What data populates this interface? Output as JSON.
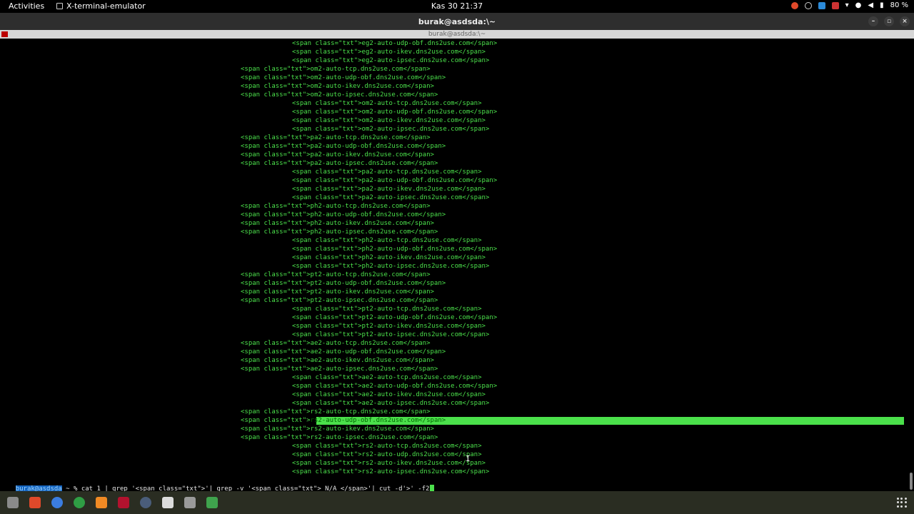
{
  "topbar": {
    "activities": "Activities",
    "app_name": "X-terminal-emulator",
    "clock": "Kas 30  21:37",
    "battery": "80 %",
    "tray_icons": [
      "brave-tray-icon",
      "settings-tray-icon",
      "app-tray-icon",
      "shield-tray-icon",
      "wifi-icon",
      "microphone-icon",
      "volume-icon",
      "battery-icon"
    ]
  },
  "window": {
    "title": "burak@asdsda:\\~",
    "tab_title": "burak@asdsda:\\~",
    "minimize": "–",
    "maximize": "▫",
    "close": "×"
  },
  "terminal": {
    "lines": [
      {
        "indent": 2,
        "text": "<span class=\"txt\">eg2-auto-udp-obf.dns2use.com</span>"
      },
      {
        "indent": 2,
        "text": "<span class=\"txt\">eg2-auto-ikev.dns2use.com</span>"
      },
      {
        "indent": 2,
        "text": "<span class=\"txt\">eg2-auto-ipsec.dns2use.com</span>"
      },
      {
        "indent": 1,
        "text": "<span class=\"txt\">om2-auto-tcp.dns2use.com</span>"
      },
      {
        "indent": 1,
        "text": "<span class=\"txt\">om2-auto-udp-obf.dns2use.com</span>"
      },
      {
        "indent": 1,
        "text": "<span class=\"txt\">om2-auto-ikev.dns2use.com</span>"
      },
      {
        "indent": 1,
        "text": "<span class=\"txt\">om2-auto-ipsec.dns2use.com</span>"
      },
      {
        "indent": 2,
        "text": "<span class=\"txt\">om2-auto-tcp.dns2use.com</span>"
      },
      {
        "indent": 2,
        "text": "<span class=\"txt\">om2-auto-udp-obf.dns2use.com</span>"
      },
      {
        "indent": 2,
        "text": "<span class=\"txt\">om2-auto-ikev.dns2use.com</span>"
      },
      {
        "indent": 2,
        "text": "<span class=\"txt\">om2-auto-ipsec.dns2use.com</span>"
      },
      {
        "indent": 1,
        "text": "<span class=\"txt\">pa2-auto-tcp.dns2use.com</span>"
      },
      {
        "indent": 1,
        "text": "<span class=\"txt\">pa2-auto-udp-obf.dns2use.com</span>"
      },
      {
        "indent": 1,
        "text": "<span class=\"txt\">pa2-auto-ikev.dns2use.com</span>"
      },
      {
        "indent": 1,
        "text": "<span class=\"txt\">pa2-auto-ipsec.dns2use.com</span>"
      },
      {
        "indent": 2,
        "text": "<span class=\"txt\">pa2-auto-tcp.dns2use.com</span>"
      },
      {
        "indent": 2,
        "text": "<span class=\"txt\">pa2-auto-udp-obf.dns2use.com</span>"
      },
      {
        "indent": 2,
        "text": "<span class=\"txt\">pa2-auto-ikev.dns2use.com</span>"
      },
      {
        "indent": 2,
        "text": "<span class=\"txt\">pa2-auto-ipsec.dns2use.com</span>"
      },
      {
        "indent": 1,
        "text": "<span class=\"txt\">ph2-auto-tcp.dns2use.com</span>"
      },
      {
        "indent": 1,
        "text": "<span class=\"txt\">ph2-auto-udp-obf.dns2use.com</span>"
      },
      {
        "indent": 1,
        "text": "<span class=\"txt\">ph2-auto-ikev.dns2use.com</span>"
      },
      {
        "indent": 1,
        "text": "<span class=\"txt\">ph2-auto-ipsec.dns2use.com</span>"
      },
      {
        "indent": 2,
        "text": "<span class=\"txt\">ph2-auto-tcp.dns2use.com</span>"
      },
      {
        "indent": 2,
        "text": "<span class=\"txt\">ph2-auto-udp-obf.dns2use.com</span>"
      },
      {
        "indent": 2,
        "text": "<span class=\"txt\">ph2-auto-ikev.dns2use.com</span>"
      },
      {
        "indent": 2,
        "text": "<span class=\"txt\">ph2-auto-ipsec.dns2use.com</span>"
      },
      {
        "indent": 1,
        "text": "<span class=\"txt\">pt2-auto-tcp.dns2use.com</span>"
      },
      {
        "indent": 1,
        "text": "<span class=\"txt\">pt2-auto-udp-obf.dns2use.com</span>"
      },
      {
        "indent": 1,
        "text": "<span class=\"txt\">pt2-auto-ikev.dns2use.com</span>"
      },
      {
        "indent": 1,
        "text": "<span class=\"txt\">pt2-auto-ipsec.dns2use.com</span>"
      },
      {
        "indent": 2,
        "text": "<span class=\"txt\">pt2-auto-tcp.dns2use.com</span>"
      },
      {
        "indent": 2,
        "text": "<span class=\"txt\">pt2-auto-udp-obf.dns2use.com</span>"
      },
      {
        "indent": 2,
        "text": "<span class=\"txt\">pt2-auto-ikev.dns2use.com</span>"
      },
      {
        "indent": 2,
        "text": "<span class=\"txt\">pt2-auto-ipsec.dns2use.com</span>"
      },
      {
        "indent": 1,
        "text": "<span class=\"txt\">ae2-auto-tcp.dns2use.com</span>"
      },
      {
        "indent": 1,
        "text": "<span class=\"txt\">ae2-auto-udp-obf.dns2use.com</span>"
      },
      {
        "indent": 1,
        "text": "<span class=\"txt\">ae2-auto-ikev.dns2use.com</span>"
      },
      {
        "indent": 1,
        "text": "<span class=\"txt\">ae2-auto-ipsec.dns2use.com</span>"
      },
      {
        "indent": 2,
        "text": "<span class=\"txt\">ae2-auto-tcp.dns2use.com</span>"
      },
      {
        "indent": 2,
        "text": "<span class=\"txt\">ae2-auto-udp-obf.dns2use.com</span>"
      },
      {
        "indent": 2,
        "text": "<span class=\"txt\">ae2-auto-ikev.dns2use.com</span>"
      },
      {
        "indent": 2,
        "text": "<span class=\"txt\">ae2-auto-ipsec.dns2use.com</span>"
      },
      {
        "indent": 1,
        "text": "<span class=\"txt\">rs2-auto-tcp.dns2use.com</span>"
      },
      {
        "indent": 1,
        "text": "<span class=\"txt\">",
        "highlight": "rs2-auto-udp-obf.dns2use.com</span>"
      },
      {
        "indent": 1,
        "text": "<span class=\"txt\">rs2-auto-ikev.dns2use.com</span>"
      },
      {
        "indent": 1,
        "text": "<span class=\"txt\">rs2-auto-ipsec.dns2use.com</span>"
      },
      {
        "indent": 2,
        "text": "<span class=\"txt\">rs2-auto-tcp.dns2use.com</span>"
      },
      {
        "indent": 2,
        "text": "<span class=\"txt\">rs2-auto-udp.dns2use.com</span>"
      },
      {
        "indent": 2,
        "text": "<span class=\"txt\">rs2-auto-ikev.dns2use.com</span>"
      },
      {
        "indent": 2,
        "text": "<span class=\"txt\">rs2-auto-ipsec.dns2use.com</span>"
      }
    ],
    "prompt_user": "burak@asdsda",
    "prompt_sep": " ~ % ",
    "command": "cat 1 | grep '<span class=\"txt\">'| grep -v '<span class=\"txt\"> N/A </span>'| cut -d'>' -f2"
  },
  "dock": {
    "items": [
      {
        "name": "files-icon",
        "color": "#8a8a8a"
      },
      {
        "name": "brave-icon",
        "color": "#e0492a"
      },
      {
        "name": "help-icon",
        "color": "#3b7de0"
      },
      {
        "name": "chrome-icon",
        "color": "#2f9e44"
      },
      {
        "name": "sublime-icon",
        "color": "#f08a24"
      },
      {
        "name": "terminal-icon",
        "color": "#b3122e"
      },
      {
        "name": "settings-icon",
        "color": "#4a5d7a"
      },
      {
        "name": "obs-icon",
        "color": "#dcdcdc"
      },
      {
        "name": "text-editor-icon",
        "color": "#9a9a9a"
      },
      {
        "name": "archive-icon",
        "color": "#3fa34d"
      }
    ]
  }
}
